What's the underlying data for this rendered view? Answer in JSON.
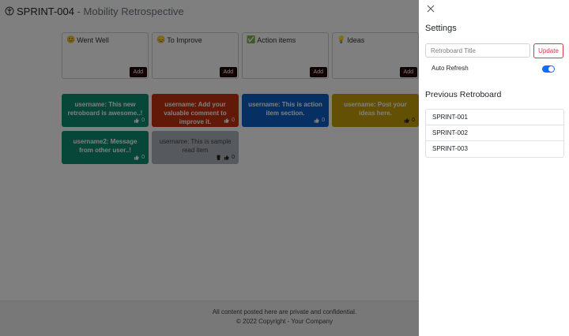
{
  "app": {
    "sprint": "SPRINT-004",
    "separator": " - ",
    "subtitle": "Mobility Retrospective"
  },
  "columns": [
    {
      "emoji": "😊",
      "title": "Went Well",
      "add_label": "Add"
    },
    {
      "emoji": "😞",
      "title": "To Improve",
      "add_label": "Add"
    },
    {
      "emoji": "✅",
      "title": "Action items",
      "add_label": "Add"
    },
    {
      "emoji": "💡",
      "title": "Ideas",
      "add_label": "Add"
    }
  ],
  "cards": [
    {
      "text": "username: This new retroboard is awesome..!",
      "likes": "0",
      "color": "#0d8f74"
    },
    {
      "text": "username: Add your valuable comment to improve it.",
      "likes": "0",
      "color": "#c4330f"
    },
    {
      "text": "username: This is action item section.",
      "likes": "0",
      "color": "#0d5fc9"
    },
    {
      "text": "username: Post your ideas here.",
      "likes": "0",
      "color": "#c7a00b"
    },
    {
      "text": "username2: Message from other user..!",
      "likes": "0",
      "color": "#0d8f74"
    },
    {
      "text": "username: This is sample read item",
      "likes": "0",
      "color": "#adb5bd"
    }
  ],
  "footer": {
    "line1": "All content posted here are private and confidential.",
    "line2": "© 2022 Copyright - Your Company"
  },
  "settings": {
    "title": "Settings",
    "input_placeholder": "Retroboard Title",
    "update_label": "Update",
    "auto_refresh_label": "Auto Refresh",
    "auto_refresh_on": true,
    "previous_title": "Previous Retroboard",
    "previous": [
      "SPRINT-001",
      "SPRINT-002",
      "SPRINT-003"
    ]
  },
  "colors": {
    "accent": "#0d6efd",
    "danger": "#dc3545"
  }
}
